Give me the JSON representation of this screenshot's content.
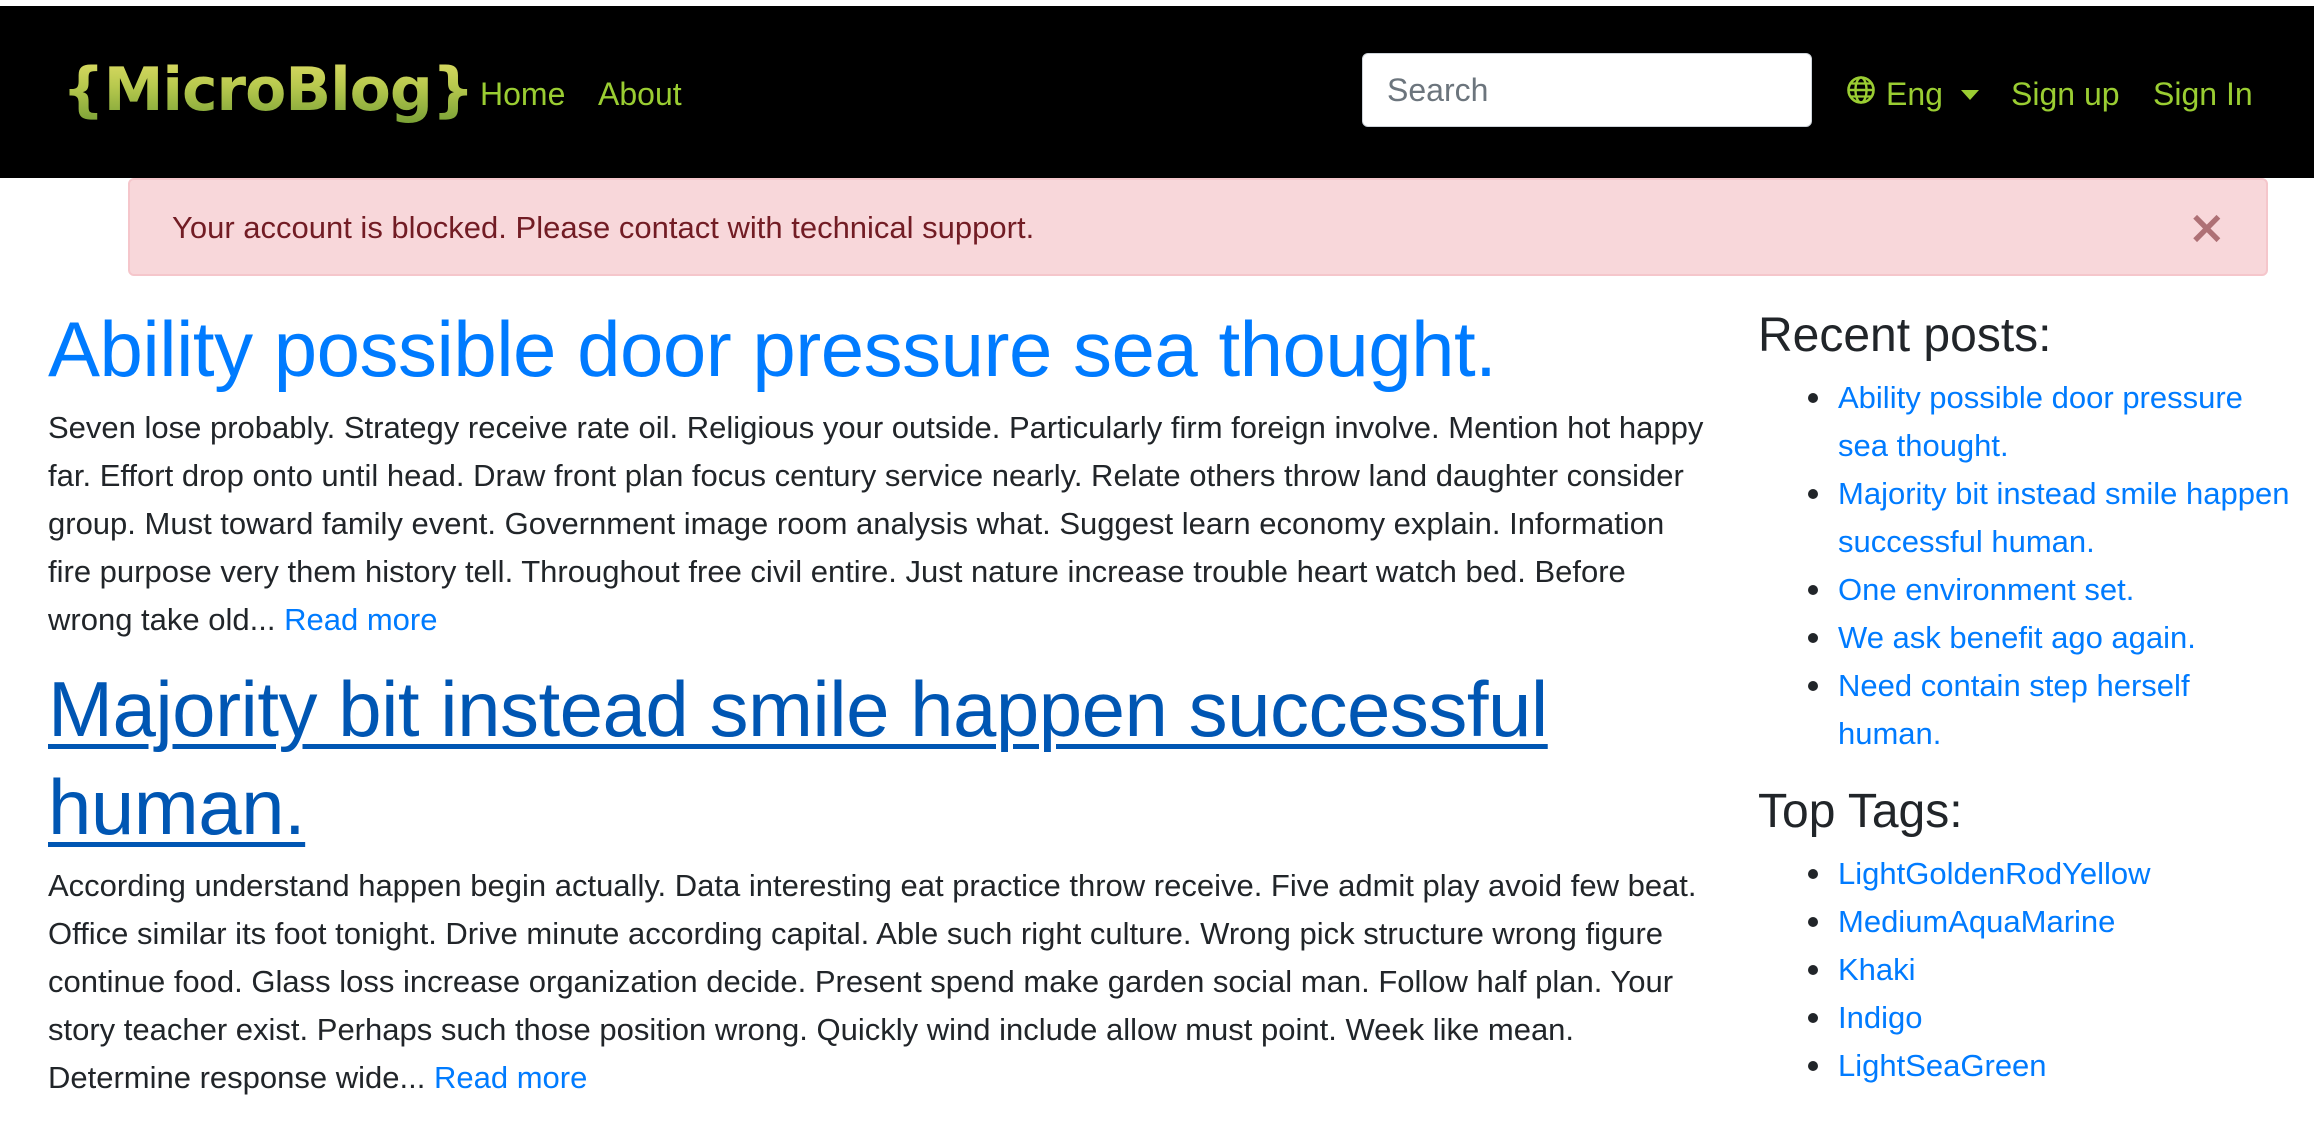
{
  "navbar": {
    "brand": "{MicroBlog}",
    "links": [
      "Home",
      "About"
    ],
    "search_placeholder": "Search",
    "language": "Eng",
    "signup": "Sign up",
    "signin": "Sign In"
  },
  "alert": {
    "message": "Your account is blocked. Please contact with technical support.",
    "close": "×"
  },
  "posts": [
    {
      "title": "Ability possible door pressure sea thought.",
      "body": "Seven lose probably. Strategy receive rate oil. Religious your outside. Particularly firm foreign involve. Mention hot happy far. Effort drop onto until head. Draw front plan focus century service nearly. Relate others throw land daughter consider group. Must toward family event. Government image room analysis what. Suggest learn economy explain. Information fire purpose very them history tell. Throughout free civil entire. Just nature increase trouble heart watch bed. Before wrong take old...",
      "read_more": "Read more"
    },
    {
      "title": "Majority bit instead smile happen successful human.",
      "body": "According understand happen begin actually. Data interesting eat practice throw receive. Five admit play avoid few beat. Office similar its foot tonight. Drive minute according capital. Able such right culture. Wrong pick structure wrong figure continue food. Glass loss increase organization decide. Present spend make garden social man. Follow half plan. Your story teacher exist. Perhaps such those position wrong. Quickly wind include allow must point. Week like mean. Determine response wide...",
      "read_more": "Read more"
    }
  ],
  "sidebar": {
    "recent_heading": "Recent posts:",
    "recent_posts": [
      "Ability possible door pressure sea thought.",
      "Majority bit instead smile happen successful human.",
      "One environment set.",
      "We ask benefit ago again.",
      "Need contain step herself human."
    ],
    "tags_heading": "Top Tags:",
    "tags": [
      "LightGoldenRodYellow",
      "MediumAquaMarine",
      "Khaki",
      "Indigo",
      "LightSeaGreen"
    ]
  },
  "colors": {
    "nav_link": "#9acd32",
    "link": "#007bff",
    "alert_bg": "#f8d7da",
    "alert_text": "#721c24"
  }
}
